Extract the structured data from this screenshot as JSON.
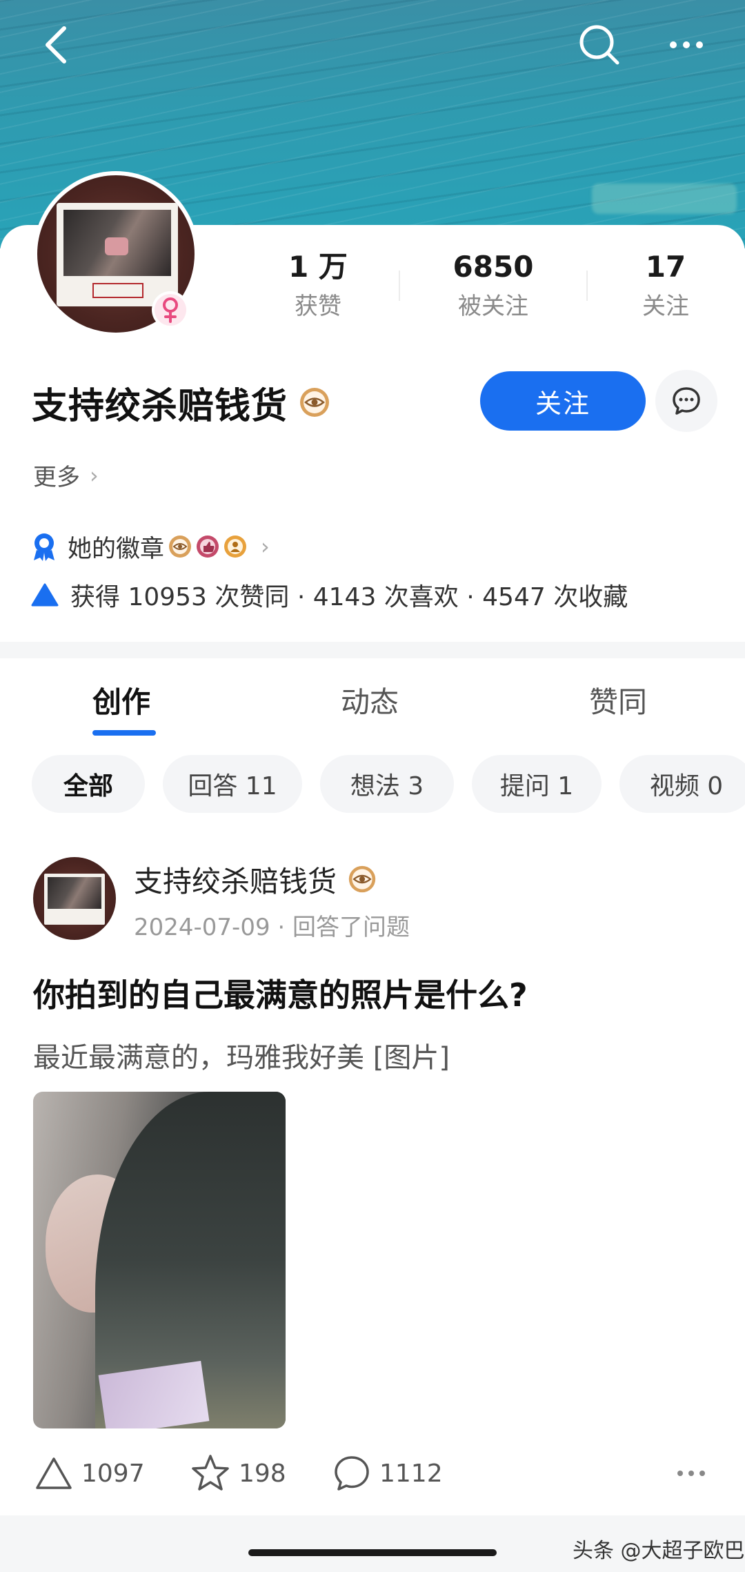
{
  "header": {
    "back_icon": "chevron-left-icon",
    "search_icon": "search-icon",
    "more_icon": "more-horizontal-icon"
  },
  "profile": {
    "username": "支持绞杀赔钱货",
    "gender": "female",
    "stats": {
      "likes_value": "1 万",
      "likes_label": "获赞",
      "followers_value": "6850",
      "followers_label": "被关注",
      "following_value": "17",
      "following_label": "关注"
    },
    "follow_label": "关注",
    "more_label": "更多",
    "badges_label": "她的徽章",
    "summary": "获得 10953 次赞同 · 4143 次喜欢 · 4547 次收藏"
  },
  "tabs": [
    {
      "label": "创作",
      "active": true
    },
    {
      "label": "动态",
      "active": false
    },
    {
      "label": "赞同",
      "active": false
    }
  ],
  "filters": [
    {
      "label": "全部",
      "active": true
    },
    {
      "label": "回答 11",
      "active": false
    },
    {
      "label": "想法 3",
      "active": false
    },
    {
      "label": "提问 1",
      "active": false
    },
    {
      "label": "视频 0",
      "active": false
    }
  ],
  "post": {
    "author": "支持绞杀赔钱货",
    "meta": "2024-07-09 · 回答了问题",
    "title": "你拍到的自己最满意的照片是什么?",
    "excerpt": "最近最满意的，玛雅我好美 [图片]",
    "upvotes": "1097",
    "favorites": "198",
    "comments": "1112"
  },
  "watermark": "头条 @大超子欧巴",
  "colors": {
    "accent": "#1a6ff0",
    "banner": "#2f9bb0",
    "badge_gold": "#d9a05b",
    "gender_pink": "#e84a7f"
  }
}
